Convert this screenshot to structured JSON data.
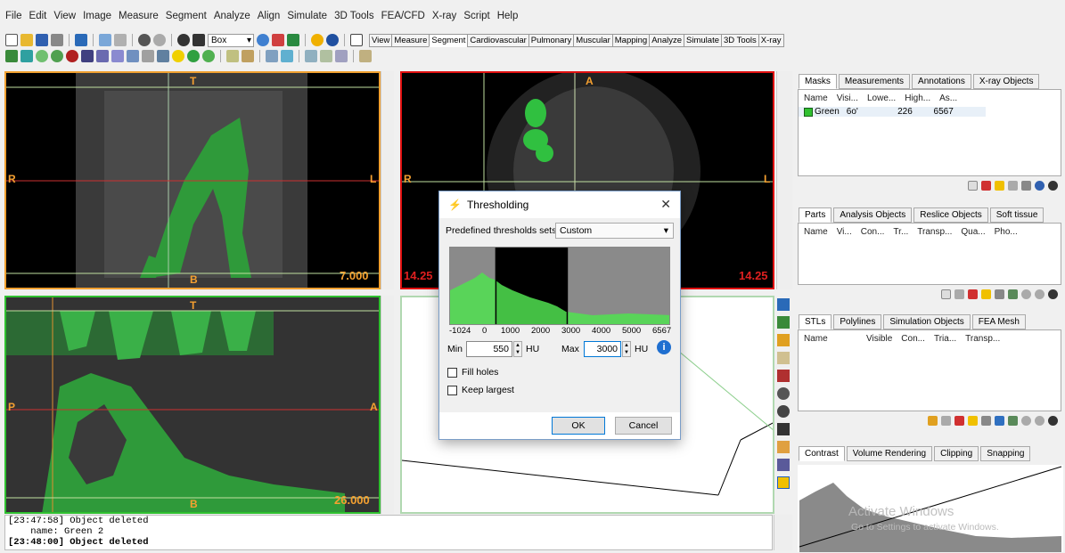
{
  "menu": [
    "File",
    "Edit",
    "View",
    "Image",
    "Measure",
    "Segment",
    "Analyze",
    "Align",
    "Simulate",
    "3D Tools",
    "FEA/CFD",
    "X-ray",
    "Script",
    "Help"
  ],
  "toolbar": {
    "box_select": "Box",
    "tabs": [
      "View",
      "Measure",
      "Segment",
      "Cardiovascular",
      "Pulmonary",
      "Muscular",
      "Mapping",
      "Analyze",
      "Simulate",
      "3D Tools",
      "X-ray"
    ],
    "active_tab": "Segment"
  },
  "viewports": {
    "top_left": {
      "top": "T",
      "bottom": "B",
      "left": "R",
      "right": "L",
      "value": "7.000"
    },
    "top_right": {
      "top": "A",
      "left": "R",
      "right": "L",
      "value_left": "14.25",
      "value_right": "14.25"
    },
    "bottom_left": {
      "top": "T",
      "bottom": "B",
      "left": "P",
      "right": "A",
      "value": "26.000"
    }
  },
  "log": [
    "[23:47:58] Object deleted",
    "    name: Green 2",
    "[23:48:00] Object deleted"
  ],
  "masks": {
    "tabs": [
      "Masks",
      "Measurements",
      "Annotations",
      "X-ray Objects"
    ],
    "headers": [
      "Name",
      "Visi...",
      "Lowe...",
      "High...",
      "As..."
    ],
    "row": {
      "name": "Green",
      "visible": "6o'",
      "lower": "226",
      "higher": "6567"
    }
  },
  "parts": {
    "tabs": [
      "Parts",
      "Analysis Objects",
      "Reslice Objects",
      "Soft tissue"
    ],
    "headers": [
      "Name",
      "Vi...",
      "Con...",
      "Tr...",
      "Transp...",
      "Qua...",
      "Pho..."
    ]
  },
  "stls": {
    "tabs": [
      "STLs",
      "Polylines",
      "Simulation Objects",
      "FEA Mesh"
    ],
    "headers": [
      "Name",
      "Visible",
      "Con...",
      "Tria...",
      "Transp..."
    ]
  },
  "contrast": {
    "tabs": [
      "Contrast",
      "Volume Rendering",
      "Clipping",
      "Snapping"
    ]
  },
  "watermark": {
    "line1": "Activate Windows",
    "line2": "Go to Settings to activate Windows."
  },
  "dialog": {
    "title": "Thresholding",
    "predefined_label": "Predefined thresholds sets:",
    "predefined_value": "Custom",
    "axis_ticks": [
      "-1024",
      "0",
      "1000",
      "2000",
      "3000",
      "4000",
      "5000",
      "6567"
    ],
    "min_label": "Min",
    "min_value": "550",
    "min_unit": "HU",
    "max_label": "Max",
    "max_value": "3000",
    "max_unit": "HU",
    "fill_holes": "Fill holes",
    "keep_largest": "Keep largest",
    "ok": "OK",
    "cancel": "Cancel",
    "histogram": {
      "range": [
        -1024,
        6567
      ],
      "min": 550,
      "max": 3000
    }
  }
}
